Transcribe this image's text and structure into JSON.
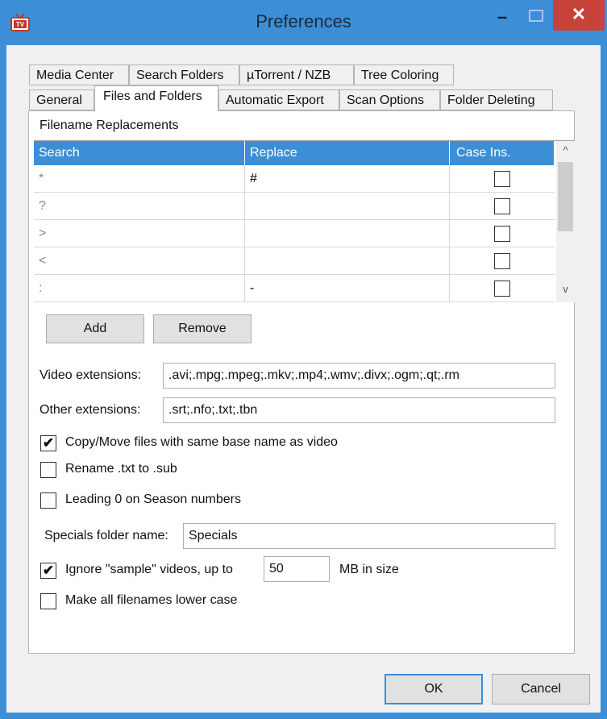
{
  "window": {
    "title": "Preferences",
    "app_icon": "tv-icon",
    "minimize": "–",
    "close": "✕"
  },
  "tabs_row1": [
    "Media Center",
    "Search Folders",
    "µTorrent / NZB",
    "Tree Coloring"
  ],
  "tabs_row2": [
    "General",
    "Files and Folders",
    "Automatic Export",
    "Scan Options",
    "Folder Deleting"
  ],
  "active_tab": "Files and Folders",
  "replacements": {
    "section_label": "Filename Replacements",
    "columns": [
      "Search",
      "Replace",
      "Case Ins."
    ],
    "rows": [
      {
        "search": "*",
        "replace": "#",
        "case_ins": false
      },
      {
        "search": "?",
        "replace": "",
        "case_ins": false
      },
      {
        "search": ">",
        "replace": "",
        "case_ins": false
      },
      {
        "search": "<",
        "replace": "",
        "case_ins": false
      },
      {
        "search": ":",
        "replace": "-",
        "case_ins": false
      }
    ],
    "add_label": "Add",
    "remove_label": "Remove",
    "scroll_up": "^",
    "scroll_down": "v"
  },
  "video_ext": {
    "label": "Video extensions:",
    "value": ".avi;.mpg;.mpeg;.mkv;.mp4;.wmv;.divx;.ogm;.qt;.rm"
  },
  "other_ext": {
    "label": "Other extensions:",
    "value": ".srt;.nfo;.txt;.tbn"
  },
  "options": {
    "copy_move": {
      "label": "Copy/Move files with same base name as video",
      "checked": true
    },
    "rename_txt": {
      "label": "Rename .txt to .sub",
      "checked": false
    },
    "leading_zero": {
      "label": "Leading 0 on Season numbers",
      "checked": false
    }
  },
  "specials": {
    "label": "Specials folder name:",
    "value": "Specials"
  },
  "ignore_sample": {
    "label": "Ignore \"sample\" videos, up to",
    "value": "50",
    "suffix": "MB in size",
    "checked": true
  },
  "lowercase": {
    "label": "Make all filenames lower case",
    "checked": false
  },
  "footer": {
    "ok_label": "OK",
    "cancel_label": "Cancel"
  },
  "colors": {
    "accent": "#3c8fd6",
    "close": "#c7433a",
    "background": "#f0f0f0"
  }
}
